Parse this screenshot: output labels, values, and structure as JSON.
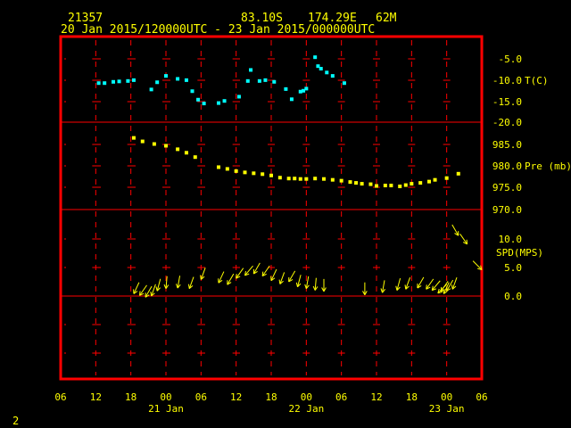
{
  "header": {
    "station_id": "21357",
    "latitude": "83.10S",
    "longitude": "174.29E",
    "elevation": "62M",
    "time_range": "20 Jan 2015/120000UTC - 23 Jan 2015/000000UTC"
  },
  "footer": {
    "page_number": "2"
  },
  "colors": {
    "background": "#000000",
    "frame": "#ff0000",
    "grid": "#ff0000",
    "temperature": "#00ffff",
    "pressure": "#ffff00",
    "wind": "#ffff00",
    "text": "#ffff00"
  },
  "chart_data": [
    {
      "type": "scatter",
      "title": "",
      "ylabel": "T(C)",
      "y_ticks": [
        "-5.0",
        "-10.0",
        "-15.0",
        "-20.0"
      ],
      "ylim": [
        -20,
        -3
      ],
      "x_hours_since_0600_20jan": true,
      "x": [
        6.5,
        7.5,
        9,
        10,
        11.5,
        12.5,
        15.5,
        16.5,
        18,
        20,
        21.5,
        22.5,
        23.5,
        24.5,
        27,
        28,
        30.5,
        32,
        32.5,
        34,
        35,
        36.5,
        38.5,
        39.5,
        41,
        41.5,
        42,
        43.5,
        44,
        44.5,
        45.5,
        46.5,
        48.5
      ],
      "y": [
        -10.8,
        -10.8,
        -10.5,
        -10.4,
        -10.3,
        -10.1,
        -12.3,
        -10.6,
        -9.1,
        -9.8,
        -10.1,
        -12.7,
        -14.7,
        -15.6,
        -15.5,
        -15.0,
        -14.0,
        -10.3,
        -7.7,
        -10.3,
        -10.1,
        -10.5,
        -12.2,
        -14.6,
        -12.8,
        -12.6,
        -12.1,
        -4.7,
        -6.8,
        -7.4,
        -8.3,
        -9.1,
        -10.8
      ]
    },
    {
      "type": "scatter",
      "title": "",
      "ylabel": "Pre (mb)",
      "y_ticks": [
        "985.0",
        "980.0",
        "975.0",
        "970.0"
      ],
      "ylim": [
        970,
        988
      ],
      "x": [
        12.5,
        14,
        16,
        18,
        20,
        21.5,
        23,
        27,
        28.5,
        30,
        31.5,
        33,
        34.5,
        36,
        37.5,
        39,
        40,
        41,
        42,
        43.5,
        45,
        46.5,
        48,
        49.5,
        50.5,
        51.5,
        53,
        54,
        55.5,
        56.5,
        58,
        59,
        60,
        61.5,
        63,
        64,
        66,
        68
      ],
      "y": [
        986.4,
        985.6,
        985.0,
        984.6,
        983.8,
        983.0,
        982.0,
        979.7,
        979.3,
        978.8,
        978.5,
        978.3,
        978.1,
        977.8,
        977.3,
        977.1,
        977.1,
        977.0,
        977.0,
        977.1,
        977.0,
        976.8,
        976.6,
        976.3,
        976.1,
        975.9,
        975.8,
        975.4,
        975.5,
        975.5,
        975.3,
        975.6,
        975.9,
        976.1,
        976.4,
        976.8,
        977.2,
        978.2
      ]
    },
    {
      "type": "scatter",
      "title": "",
      "ylabel": "SPD(MPS)",
      "y_ticks": [
        "10.0",
        "5.0",
        "0.0"
      ],
      "ylim": [
        -2,
        12
      ],
      "x": [
        12.5,
        13.5,
        14.5,
        15.5,
        16.5,
        18,
        20,
        22,
        24,
        27,
        28.5,
        30,
        31.5,
        33,
        34.5,
        36,
        37.5,
        39,
        40.5,
        42,
        43.5,
        45,
        52,
        55,
        57.5,
        59,
        61,
        62.5,
        63.5,
        64.5,
        65,
        65.5,
        66,
        67,
        68,
        69.5,
        72
      ],
      "y": [
        0.4,
        0.1,
        -0.2,
        0.0,
        0.9,
        1.3,
        1.4,
        1.3,
        2.9,
        2.3,
        2.0,
        3.1,
        3.6,
        3.9,
        3.5,
        2.7,
        2.1,
        2.5,
        1.6,
        1.3,
        1.0,
        0.8,
        0.2,
        0.6,
        1.0,
        1.2,
        1.4,
        1.2,
        1.0,
        0.5,
        0.8,
        0.4,
        0.9,
        1.2,
        10.6,
        9.1,
        4.6
      ]
    }
  ],
  "x_axis": {
    "hour_ticks": [
      "06",
      "12",
      "18",
      "00",
      "06",
      "12",
      "18",
      "00",
      "06",
      "12",
      "18",
      "00",
      "06"
    ],
    "day_labels": [
      "21 Jan",
      "22 Jan",
      "23 Jan"
    ]
  }
}
